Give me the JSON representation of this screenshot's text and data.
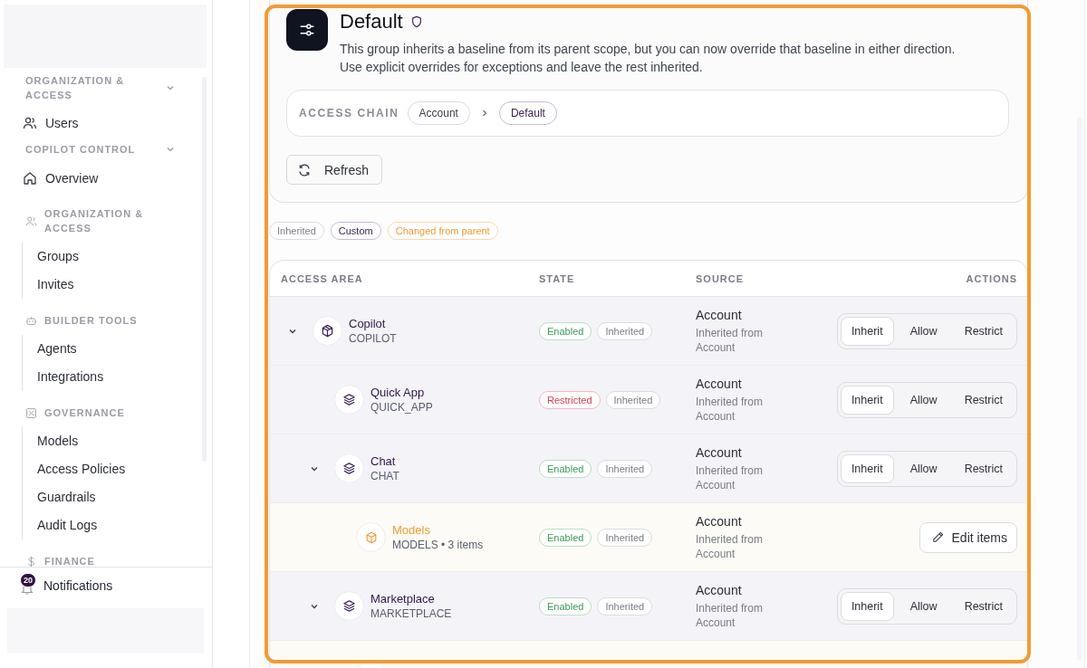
{
  "sidebar": {
    "sections": [
      {
        "kind": "top",
        "title": "ORGANIZATION & ACCESS",
        "expanded": true,
        "items": [
          {
            "label": "Users"
          }
        ]
      },
      {
        "kind": "top",
        "title": "COPILOT CONTROL",
        "expanded": true,
        "items": [
          {
            "label": "Overview"
          }
        ]
      },
      {
        "kind": "group",
        "title": "ORGANIZATION & ACCESS",
        "items": [
          {
            "label": "Groups"
          },
          {
            "label": "Invites"
          }
        ]
      },
      {
        "kind": "group",
        "title": "BUILDER TOOLS",
        "items": [
          {
            "label": "Agents"
          },
          {
            "label": "Integrations"
          }
        ]
      },
      {
        "kind": "group",
        "title": "GOVERNANCE",
        "items": [
          {
            "label": "Models"
          },
          {
            "label": "Access Policies"
          },
          {
            "label": "Guardrails"
          },
          {
            "label": "Audit Logs"
          }
        ]
      },
      {
        "kind": "group",
        "title": "FINANCE"
      }
    ],
    "notifications": {
      "label": "Notifications",
      "count": "20"
    }
  },
  "header": {
    "title": "Default",
    "description": "This group inherits a baseline from its parent scope, but you can now override that baseline in either direction. Use explicit overrides for exceptions and leave the rest inherited.",
    "access_chain": {
      "label": "ACCESS CHAIN",
      "steps": [
        {
          "label": "Account",
          "current": false
        },
        {
          "label": "Default",
          "current": true
        }
      ]
    },
    "refresh": "Refresh"
  },
  "legend": [
    {
      "label": "Inherited",
      "kind": "inherited"
    },
    {
      "label": "Custom",
      "kind": "custom"
    },
    {
      "label": "Changed from parent",
      "kind": "changed"
    }
  ],
  "table": {
    "columns": [
      "ACCESS AREA",
      "STATE",
      "SOURCE",
      "ACTIONS"
    ],
    "rows": [
      {
        "kind": "area",
        "name": "Copilot",
        "code": "COPILOT",
        "expanded": true,
        "badges": [
          {
            "label": "Enabled",
            "kind": "enabled"
          },
          {
            "label": "Inherited",
            "kind": "inherited"
          }
        ],
        "source": "Account",
        "source_note": "Inherited from Account",
        "modes": [
          {
            "label": "Inherit",
            "selected": true
          },
          {
            "label": "Allow",
            "selected": false
          },
          {
            "label": "Restrict",
            "selected": false
          }
        ],
        "children": [
          {
            "kind": "area",
            "name": "Quick App",
            "code": "QUICK_APP",
            "badges": [
              {
                "label": "Restricted",
                "kind": "restricted"
              },
              {
                "label": "Inherited",
                "kind": "inherited"
              }
            ],
            "source": "Account",
            "source_note": "Inherited from Account",
            "modes": [
              {
                "label": "Inherit",
                "selected": true
              },
              {
                "label": "Allow",
                "selected": false
              },
              {
                "label": "Restrict",
                "selected": false
              }
            ]
          },
          {
            "kind": "area",
            "name": "Chat",
            "code": "CHAT",
            "expanded": true,
            "badges": [
              {
                "label": "Enabled",
                "kind": "enabled"
              },
              {
                "label": "Inherited",
                "kind": "inherited"
              }
            ],
            "source": "Account",
            "source_note": "Inherited from Account",
            "modes": [
              {
                "label": "Inherit",
                "selected": true
              },
              {
                "label": "Allow",
                "selected": false
              },
              {
                "label": "Restrict",
                "selected": false
              }
            ],
            "children": [
              {
                "kind": "collection",
                "name": "Models",
                "code": "MODELS • 3 items",
                "badges": [
                  {
                    "label": "Enabled",
                    "kind": "enabled"
                  },
                  {
                    "label": "Inherited",
                    "kind": "inherited"
                  }
                ],
                "source": "Account",
                "source_note": "Inherited from Account",
                "action": "Edit items"
              }
            ]
          },
          {
            "kind": "area",
            "name": "Marketplace",
            "code": "MARKETPLACE",
            "expanded": true,
            "badges": [
              {
                "label": "Enabled",
                "kind": "enabled"
              },
              {
                "label": "Inherited",
                "kind": "inherited"
              }
            ],
            "source": "Account",
            "source_note": "Inherited from Account",
            "modes": [
              {
                "label": "Inherit",
                "selected": true
              },
              {
                "label": "Allow",
                "selected": false
              },
              {
                "label": "Restrict",
                "selected": false
              }
            ],
            "children": [
              {
                "kind": "collection"
              }
            ]
          }
        ]
      }
    ]
  }
}
